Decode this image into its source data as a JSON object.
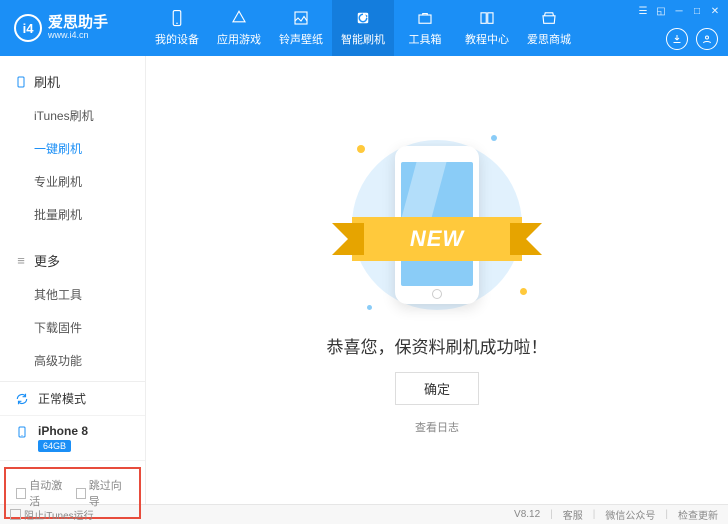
{
  "logo": {
    "mark": "i4",
    "name": "爱思助手",
    "site": "www.i4.cn"
  },
  "topTabs": [
    {
      "label": "我的设备"
    },
    {
      "label": "应用游戏"
    },
    {
      "label": "铃声壁纸"
    },
    {
      "label": "智能刷机"
    },
    {
      "label": "工具箱"
    },
    {
      "label": "教程中心"
    },
    {
      "label": "爱思商城"
    }
  ],
  "sidebar": {
    "section1": {
      "title": "刷机",
      "items": [
        "iTunes刷机",
        "一键刷机",
        "专业刷机",
        "批量刷机"
      ]
    },
    "section2": {
      "title": "更多",
      "items": [
        "其他工具",
        "下载固件",
        "高级功能"
      ]
    }
  },
  "status": {
    "mode": "正常模式",
    "device": "iPhone 8",
    "storage": "64GB"
  },
  "checks": {
    "autoActivate": "自动激活",
    "skipGuide": "跳过向导"
  },
  "main": {
    "ribbon": "NEW",
    "success": "恭喜您，保资料刷机成功啦！",
    "ok": "确定",
    "viewLog": "查看日志"
  },
  "footer": {
    "blockItunes": "阻止iTunes运行",
    "version": "V8.12",
    "support": "客服",
    "wechat": "微信公众号",
    "update": "检查更新"
  }
}
